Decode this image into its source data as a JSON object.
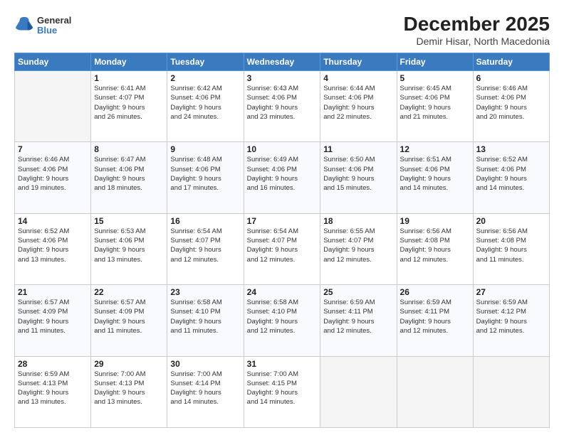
{
  "logo": {
    "general": "General",
    "blue": "Blue"
  },
  "title": "December 2025",
  "subtitle": "Demir Hisar, North Macedonia",
  "headers": [
    "Sunday",
    "Monday",
    "Tuesday",
    "Wednesday",
    "Thursday",
    "Friday",
    "Saturday"
  ],
  "weeks": [
    [
      {
        "day": "",
        "info": ""
      },
      {
        "day": "1",
        "info": "Sunrise: 6:41 AM\nSunset: 4:07 PM\nDaylight: 9 hours\nand 26 minutes."
      },
      {
        "day": "2",
        "info": "Sunrise: 6:42 AM\nSunset: 4:06 PM\nDaylight: 9 hours\nand 24 minutes."
      },
      {
        "day": "3",
        "info": "Sunrise: 6:43 AM\nSunset: 4:06 PM\nDaylight: 9 hours\nand 23 minutes."
      },
      {
        "day": "4",
        "info": "Sunrise: 6:44 AM\nSunset: 4:06 PM\nDaylight: 9 hours\nand 22 minutes."
      },
      {
        "day": "5",
        "info": "Sunrise: 6:45 AM\nSunset: 4:06 PM\nDaylight: 9 hours\nand 21 minutes."
      },
      {
        "day": "6",
        "info": "Sunrise: 6:46 AM\nSunset: 4:06 PM\nDaylight: 9 hours\nand 20 minutes."
      }
    ],
    [
      {
        "day": "7",
        "info": "Sunrise: 6:46 AM\nSunset: 4:06 PM\nDaylight: 9 hours\nand 19 minutes."
      },
      {
        "day": "8",
        "info": "Sunrise: 6:47 AM\nSunset: 4:06 PM\nDaylight: 9 hours\nand 18 minutes."
      },
      {
        "day": "9",
        "info": "Sunrise: 6:48 AM\nSunset: 4:06 PM\nDaylight: 9 hours\nand 17 minutes."
      },
      {
        "day": "10",
        "info": "Sunrise: 6:49 AM\nSunset: 4:06 PM\nDaylight: 9 hours\nand 16 minutes."
      },
      {
        "day": "11",
        "info": "Sunrise: 6:50 AM\nSunset: 4:06 PM\nDaylight: 9 hours\nand 15 minutes."
      },
      {
        "day": "12",
        "info": "Sunrise: 6:51 AM\nSunset: 4:06 PM\nDaylight: 9 hours\nand 14 minutes."
      },
      {
        "day": "13",
        "info": "Sunrise: 6:52 AM\nSunset: 4:06 PM\nDaylight: 9 hours\nand 14 minutes."
      }
    ],
    [
      {
        "day": "14",
        "info": "Sunrise: 6:52 AM\nSunset: 4:06 PM\nDaylight: 9 hours\nand 13 minutes."
      },
      {
        "day": "15",
        "info": "Sunrise: 6:53 AM\nSunset: 4:06 PM\nDaylight: 9 hours\nand 13 minutes."
      },
      {
        "day": "16",
        "info": "Sunrise: 6:54 AM\nSunset: 4:07 PM\nDaylight: 9 hours\nand 12 minutes."
      },
      {
        "day": "17",
        "info": "Sunrise: 6:54 AM\nSunset: 4:07 PM\nDaylight: 9 hours\nand 12 minutes."
      },
      {
        "day": "18",
        "info": "Sunrise: 6:55 AM\nSunset: 4:07 PM\nDaylight: 9 hours\nand 12 minutes."
      },
      {
        "day": "19",
        "info": "Sunrise: 6:56 AM\nSunset: 4:08 PM\nDaylight: 9 hours\nand 12 minutes."
      },
      {
        "day": "20",
        "info": "Sunrise: 6:56 AM\nSunset: 4:08 PM\nDaylight: 9 hours\nand 11 minutes."
      }
    ],
    [
      {
        "day": "21",
        "info": "Sunrise: 6:57 AM\nSunset: 4:09 PM\nDaylight: 9 hours\nand 11 minutes."
      },
      {
        "day": "22",
        "info": "Sunrise: 6:57 AM\nSunset: 4:09 PM\nDaylight: 9 hours\nand 11 minutes."
      },
      {
        "day": "23",
        "info": "Sunrise: 6:58 AM\nSunset: 4:10 PM\nDaylight: 9 hours\nand 11 minutes."
      },
      {
        "day": "24",
        "info": "Sunrise: 6:58 AM\nSunset: 4:10 PM\nDaylight: 9 hours\nand 12 minutes."
      },
      {
        "day": "25",
        "info": "Sunrise: 6:59 AM\nSunset: 4:11 PM\nDaylight: 9 hours\nand 12 minutes."
      },
      {
        "day": "26",
        "info": "Sunrise: 6:59 AM\nSunset: 4:11 PM\nDaylight: 9 hours\nand 12 minutes."
      },
      {
        "day": "27",
        "info": "Sunrise: 6:59 AM\nSunset: 4:12 PM\nDaylight: 9 hours\nand 12 minutes."
      }
    ],
    [
      {
        "day": "28",
        "info": "Sunrise: 6:59 AM\nSunset: 4:13 PM\nDaylight: 9 hours\nand 13 minutes."
      },
      {
        "day": "29",
        "info": "Sunrise: 7:00 AM\nSunset: 4:13 PM\nDaylight: 9 hours\nand 13 minutes."
      },
      {
        "day": "30",
        "info": "Sunrise: 7:00 AM\nSunset: 4:14 PM\nDaylight: 9 hours\nand 14 minutes."
      },
      {
        "day": "31",
        "info": "Sunrise: 7:00 AM\nSunset: 4:15 PM\nDaylight: 9 hours\nand 14 minutes."
      },
      {
        "day": "",
        "info": ""
      },
      {
        "day": "",
        "info": ""
      },
      {
        "day": "",
        "info": ""
      }
    ]
  ]
}
